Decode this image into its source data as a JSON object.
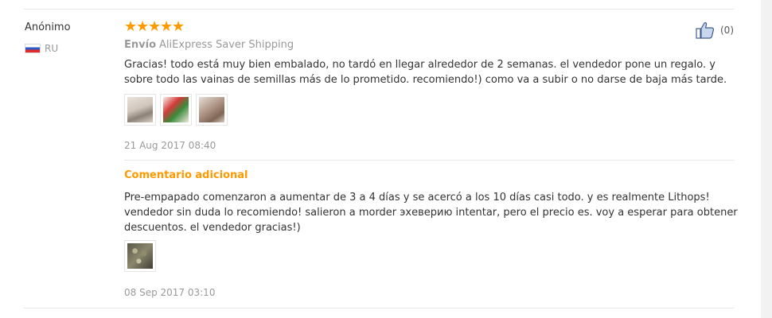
{
  "review": {
    "user": {
      "name": "Anónimo",
      "country": "RU",
      "flag_icon": "russia-flag-icon"
    },
    "rating": {
      "stars": 5,
      "max": 5,
      "star_char": "★",
      "color": "#ff9900"
    },
    "shipping": {
      "label": "Envío",
      "value": "AliExpress Saver Shipping"
    },
    "text": "Gracias! todo está muy bien embalado, no tardó en llegar alrededor de 2 semanas. el vendedor pone un regalo. y sobre todo las vainas de semillas más de lo prometido. recomiendo!) como va a subir o no darse de baja más tarde.",
    "photos": [
      "review-photo-1",
      "review-photo-2",
      "review-photo-3"
    ],
    "date": "21 Aug 2017 08:40",
    "helpful": {
      "icon": "thumbs-up-icon",
      "count": "(0)"
    },
    "additional": {
      "label": "Comentario adicional",
      "text": "Pre-empapado comenzaron a aumentar de 3 a 4 días y se acercó a los 10 días casi todo. y es realmente Lithops! vendedor sin duda lo recomiendo! salieron a morder эхеверию intentar, pero el precio es. voy a esperar para obtener descuentos. el vendedor gracias!)",
      "photos": [
        "additional-photo-1"
      ],
      "date": "08 Sep 2017 03:10"
    }
  },
  "colors": {
    "accent": "#ff9900",
    "muted": "#999999",
    "text": "#333333",
    "divider": "#e8e8e8"
  }
}
